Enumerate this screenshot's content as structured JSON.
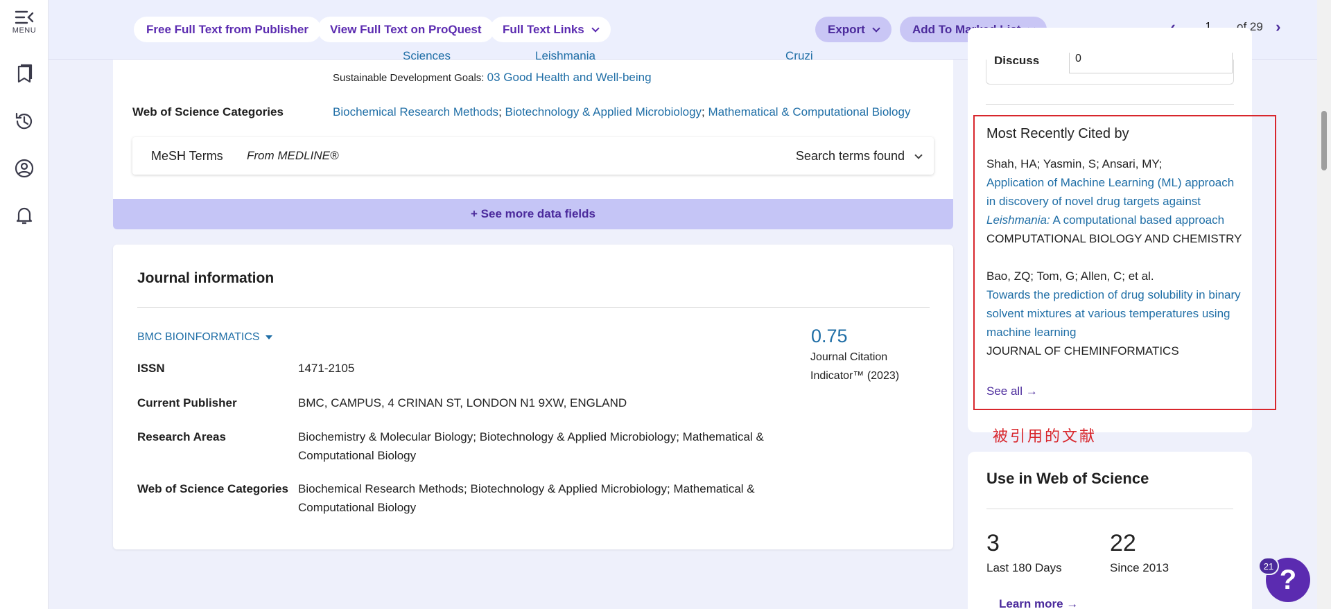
{
  "rail": {
    "menu_label": "MENU"
  },
  "toolbar": {
    "free_full_text": "Free Full Text from Publisher",
    "view_proquest": "View Full Text on ProQuest",
    "full_text_links": "Full Text Links",
    "export": "Export",
    "add_marked": "Add To Marked List",
    "page_current": "1",
    "page_of": "of 29"
  },
  "record": {
    "cut_labels": [
      "Sciences",
      "Leishmania",
      "Cruzi"
    ],
    "sdg_label": "Sustainable Development Goals:",
    "sdg_value": "03 Good Health and Well-being",
    "wos_categories_label": "Web of Science Categories",
    "wos_categories": [
      "Biochemical Research Methods",
      "Biotechnology & Applied Microbiology",
      "Mathematical & Computational Biology"
    ],
    "mesh_title": "MeSH Terms",
    "mesh_source": "From MEDLINE®",
    "mesh_right": "Search terms found",
    "see_more": "+ See more data fields"
  },
  "journal": {
    "title": "Journal information",
    "name": "BMC BIOINFORMATICS",
    "rows": [
      {
        "k": "ISSN",
        "v": "1471-2105"
      },
      {
        "k": "Current Publisher",
        "v": "BMC, CAMPUS, 4 CRINAN ST, LONDON N1 9XW, ENGLAND"
      },
      {
        "k": "Research Areas",
        "v": "Biochemistry & Molecular Biology; Biotechnology & Applied Microbiology; Mathematical & Computational Biology"
      },
      {
        "k": "Web of Science Categories",
        "v": "Biochemical Research Methods; Biotechnology & Applied Microbiology; Mathematical & Computational Biology"
      }
    ],
    "jci_value": "0.75",
    "jci_label": "Journal Citation Indicator™ (2023)"
  },
  "sidebar": {
    "discuss_label": "Discuss",
    "discuss_value": "0",
    "recent_title": "Most Recently Cited by",
    "citations": [
      {
        "authors": "Shah, HA; Yasmin, S; Ansari, MY;",
        "title_pre": "Application of Machine Learning (ML) approach in discovery of novel drug targets against ",
        "title_italic": "Leishmania:",
        "title_post": " A computational based approach",
        "journal": "COMPUTATIONAL BIOLOGY AND CHEMISTRY"
      },
      {
        "authors": "Bao, ZQ; Tom, G; Allen, C; et al.",
        "title_pre": "Towards the prediction of drug solubility in binary solvent mixtures at various temperatures using machine learning",
        "title_italic": "",
        "title_post": "",
        "journal": "JOURNAL OF CHEMINFORMATICS"
      }
    ],
    "see_all": "See all →",
    "annotation": "被引用的文献",
    "use_title": "Use in Web of Science",
    "stats": [
      {
        "n": "3",
        "l": "Last 180 Days"
      },
      {
        "n": "22",
        "l": "Since 2013"
      }
    ],
    "learn_more": "Learn more →"
  },
  "help": {
    "glyph": "?",
    "badge": "21"
  },
  "colors": {
    "accent": "#5b2bb0",
    "link": "#1f6ea6",
    "highlight": "#d8262c",
    "background": "#eef0fb"
  }
}
